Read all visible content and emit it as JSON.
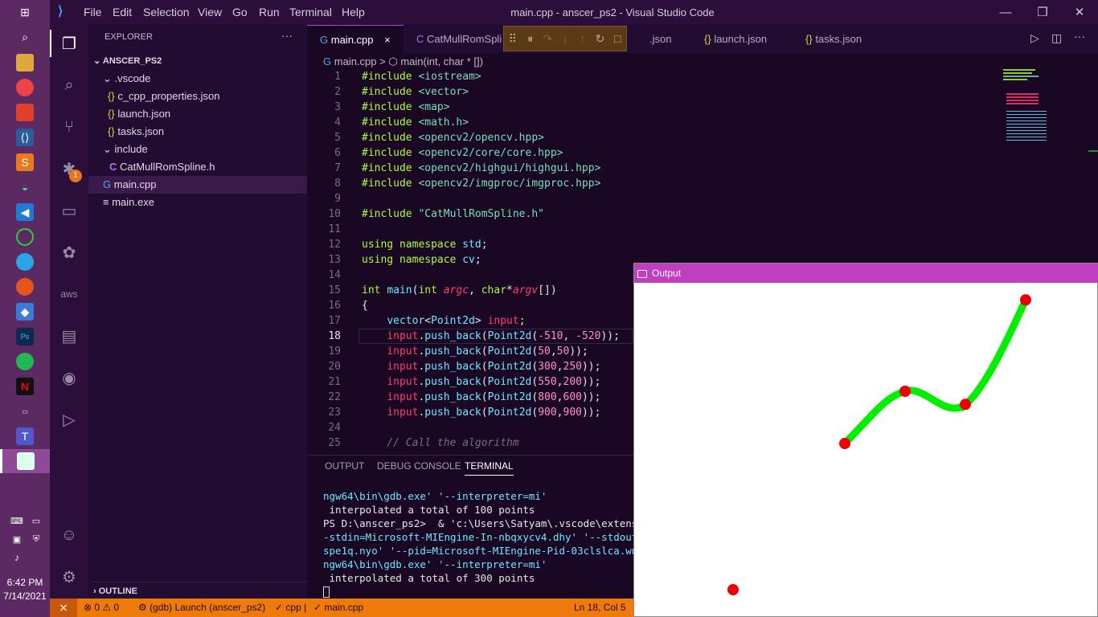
{
  "window": {
    "title": "main.cpp - anscer_ps2 - Visual Studio Code"
  },
  "menu": [
    "File",
    "Edit",
    "Selection",
    "View",
    "Go",
    "Run",
    "Terminal",
    "Help"
  ],
  "explorer": {
    "header": "EXPLORER",
    "more": "···",
    "root": "ANSCER_PS2",
    "items": [
      {
        "label": ".vscode",
        "icon": "chevron-down-icon"
      },
      {
        "label": "c_cpp_properties.json",
        "icon": "{}"
      },
      {
        "label": "launch.json",
        "icon": "{}"
      },
      {
        "label": "tasks.json",
        "icon": "{}"
      },
      {
        "label": "include",
        "icon": "chevron-down-icon"
      },
      {
        "label": "CatMullRomSpline.h",
        "icon": "C"
      },
      {
        "label": "main.cpp",
        "icon": "G"
      },
      {
        "label": "main.exe",
        "icon": "≡"
      }
    ],
    "outline": "OUTLINE"
  },
  "tabs": [
    {
      "label": "main.cpp",
      "icon": "G",
      "close": "×"
    },
    {
      "label": "CatMullRomSpli",
      "icon": "C"
    },
    {
      "label": ".json",
      "icon": ""
    },
    {
      "label": "launch.json",
      "icon": "{}"
    },
    {
      "label": "tasks.json",
      "icon": "{}"
    }
  ],
  "breadcrumb": {
    "file": "main.cpp",
    "sep": ">",
    "symbol": "main(int, char * [])"
  },
  "code": {
    "line_numbers": [
      "1",
      "2",
      "3",
      "4",
      "5",
      "6",
      "7",
      "8",
      "9",
      "10",
      "11",
      "12",
      "13",
      "14",
      "15",
      "16",
      "17",
      "18",
      "19",
      "20",
      "21",
      "22",
      "23",
      "24",
      "25"
    ],
    "current_line": 18
  },
  "panel": {
    "tabs": [
      "OUTPUT",
      "DEBUG CONSOLE",
      "TERMINAL"
    ],
    "active": "TERMINAL",
    "lines": [
      "ngw64\\bin\\gdb.exe' '--interpreter=mi'",
      " interpolated a total of 100 points",
      "PS D:\\anscer_ps2>  & 'c:\\Users\\Satyam\\.vscode\\extension",
      "-stdin=Microsoft-MIEngine-In-nbqxycv4.dhy' '--stdout=Mi",
      "spe1q.nyo' '--pid=Microsoft-MIEngine-Pid-03clslca.wns'",
      "ngw64\\bin\\gdb.exe' '--interpreter=mi'",
      " interpolated a total of 300 points",
      ""
    ]
  },
  "status": {
    "errors": "⊗ 0",
    "warnings": "⚠ 0",
    "launch": "(gdb) Launch (anscer_ps2)",
    "lang": "✓ cpp |",
    "file": "✓ main.cpp",
    "position": "Ln 18, Col 5"
  },
  "output_window": {
    "title": "Output",
    "points": [
      [
        -510,
        -520
      ],
      [
        50,
        50
      ],
      [
        300,
        250
      ],
      [
        550,
        200
      ],
      [
        800,
        600
      ],
      [
        900,
        900
      ]
    ],
    "curve_color": "#00ee00",
    "point_color": "#ee0000"
  },
  "clock": {
    "time": "6:42 PM",
    "date": "7/14/2021"
  },
  "badges": {
    "debug": "1"
  },
  "colors": {
    "accent": "#a44ad0",
    "status_bar": "#ee7a09",
    "output_titlebar": "#c13ec1"
  }
}
